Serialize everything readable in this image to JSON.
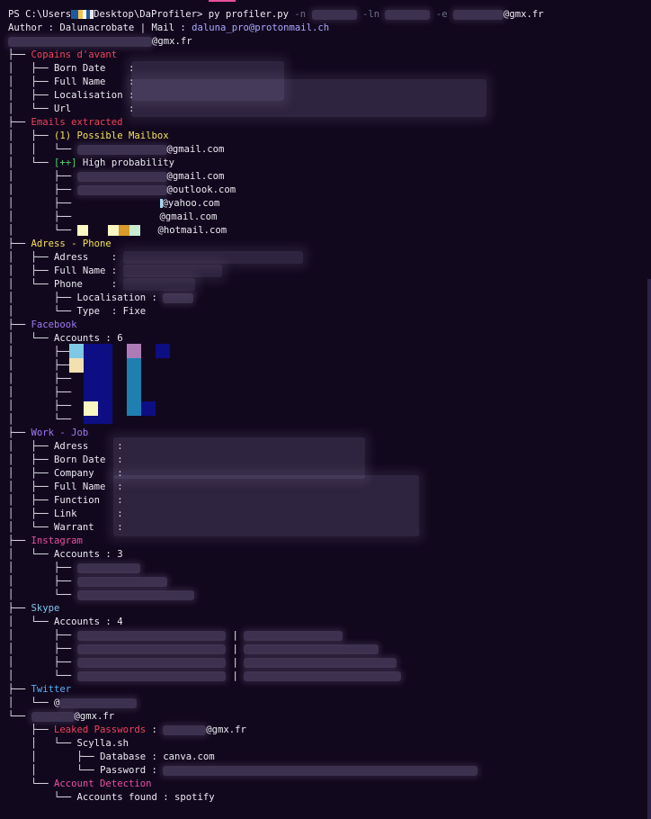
{
  "prompt": {
    "prefix": "PS C:\\Users",
    "middle": "Desktop\\DaProfiler> ",
    "cmd": "py profiler.py ",
    "flag_n": "-n",
    "flag_ln": "-ln",
    "flag_e": "-e",
    "email_suffix": "@gmx.fr"
  },
  "author": {
    "prefix": "Author : Dalunacrobate | Mail : ",
    "mail": "daluna_pro@protonmail.ch"
  },
  "root": {
    "email_suffix": "@gmx.fr"
  },
  "copains": {
    "title": "Copains d'avant",
    "fields": [
      "Born Date    :",
      "Full Name    :",
      "Localisation :",
      "Url          :"
    ]
  },
  "emails": {
    "title": "Emails extracted",
    "possible": "(1) Possible Mailbox",
    "possible_email": "@gmail.com",
    "high_mark": "[++]",
    "high": " High probability",
    "list": [
      "@gmail.com",
      "@outlook.com",
      "@yahoo.com",
      "@gmail.com",
      "@hotmail.com"
    ]
  },
  "adress": {
    "title": "Adress - Phone",
    "adress": "Adress    :",
    "fullname": "Full Name :",
    "phone": "Phone     :",
    "localisation": "Localisation :",
    "type": "Type  : Fixe"
  },
  "facebook": {
    "title": "Facebook",
    "accounts": "Accounts : 6"
  },
  "work": {
    "title": "Work - Job",
    "fields": [
      "Adress     :",
      "Born Date  :",
      "Company    :",
      "Full Name  :",
      "Function   :",
      "Link       :",
      "Warrant    :"
    ]
  },
  "instagram": {
    "title": "Instagram",
    "accounts": "Accounts : 3"
  },
  "skype": {
    "title": "Skype",
    "accounts": "Accounts : 4"
  },
  "twitter": {
    "title": "Twitter",
    "handle": "@"
  },
  "second": {
    "email_suffix": "@gmx.fr",
    "leaked": "Leaked Passwords",
    "leaked_sep": " : ",
    "leaked_suffix": "@gmx.fr",
    "scylla": "Scylla.sh",
    "database_label": "Database : ",
    "database_value": "canva.com",
    "password_label": "Password : ",
    "detection": "Account Detection",
    "found": "Accounts found : spotify"
  },
  "colors": {
    "background": "#12081e",
    "text": "#eceaf2",
    "red": "#f0435a",
    "pink": "#ec4fa2",
    "yellow": "#f4e25a",
    "purple": "#9f79f0",
    "blue": "#5ab0f4",
    "green": "#52d56b",
    "mail": "#a9a9ff"
  }
}
